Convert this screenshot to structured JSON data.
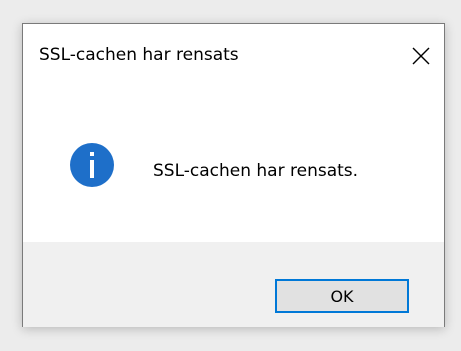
{
  "dialog": {
    "title": "SSL-cachen har rensats",
    "close_icon": "close-icon",
    "message": "SSL-cachen har rensats.",
    "message_icon": "info-icon",
    "ok_label": "OK"
  },
  "colors": {
    "accent": "#0078d7",
    "info_icon_fill": "#1e6fc9",
    "footer_bg": "#f0f0f0",
    "button_bg": "#e1e1e1"
  }
}
